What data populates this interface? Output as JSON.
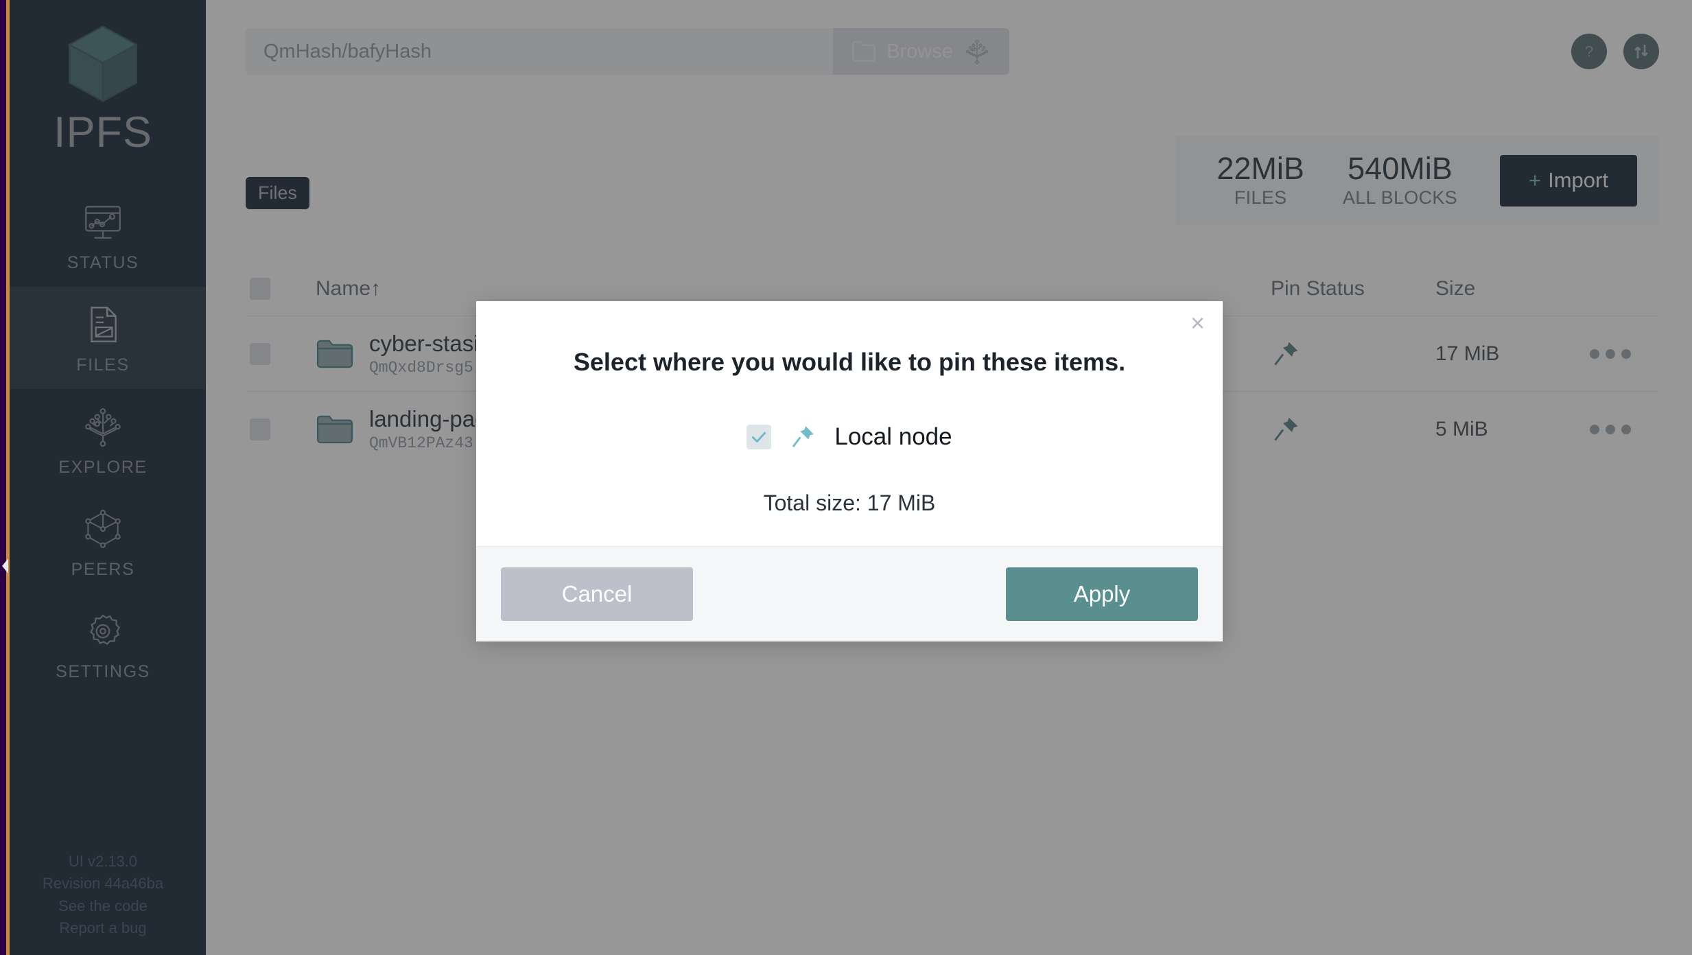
{
  "app": {
    "name": "IPFS",
    "colors": {
      "sidebar_bg": "#0b1d2c",
      "accent_teal": "#5a8f90",
      "pin_teal": "#4c7c80",
      "import_bg": "#0b1d2c",
      "cancel_gray": "#bdc0ca"
    }
  },
  "sidebar": {
    "logo_label": "IPFS",
    "items": [
      {
        "label": "STATUS",
        "icon": "monitor-chart-icon",
        "active": false
      },
      {
        "label": "FILES",
        "icon": "file-document-icon",
        "active": true
      },
      {
        "label": "EXPLORE",
        "icon": "merkle-tree-icon",
        "active": false
      },
      {
        "label": "PEERS",
        "icon": "cube-icon",
        "active": false
      },
      {
        "label": "SETTINGS",
        "icon": "gear-icon",
        "active": false
      }
    ],
    "footer": {
      "version": "UI v2.13.0",
      "revision": "Revision 44a46ba",
      "see_code": "See the code",
      "report_bug": "Report a bug"
    }
  },
  "header": {
    "search_placeholder": "QmHash/bafyHash",
    "search_value": "",
    "browse_label": "Browse",
    "browse_icon": "folder-icon",
    "explore_icon": "merkle-tree-icon",
    "help_icon": "question-mark-icon",
    "connection_icon": "up-down-arrows-icon"
  },
  "breadcrumb": {
    "label": "Files"
  },
  "stats": {
    "files": {
      "value": "22MiB",
      "label": "FILES"
    },
    "blocks": {
      "value": "540MiB",
      "label": "ALL BLOCKS"
    },
    "import_label": "Import",
    "import_plus": "+"
  },
  "table": {
    "columns": {
      "name": "Name",
      "sort_arrow": "↑",
      "pin_status": "Pin Status",
      "size": "Size"
    },
    "rows": [
      {
        "name": "cyber-stasis",
        "cid": "QmQxd8Drsg5",
        "pin_icon": "pin-icon",
        "size": "17 MiB",
        "menu_icon": "more-options-icon"
      },
      {
        "name": "landing-page",
        "cid": "QmVB12PAz43",
        "pin_icon": "pin-icon",
        "size": "5 MiB",
        "menu_icon": "more-options-icon"
      }
    ]
  },
  "modal": {
    "close_icon": "close-icon",
    "close_glyph": "×",
    "title": "Select where you would like to pin these items.",
    "options": [
      {
        "label": "Local node",
        "checked": true,
        "icon": "pin-icon",
        "check_glyph": "✓"
      }
    ],
    "total_size": "Total size: 17 MiB",
    "cancel_label": "Cancel",
    "apply_label": "Apply"
  }
}
